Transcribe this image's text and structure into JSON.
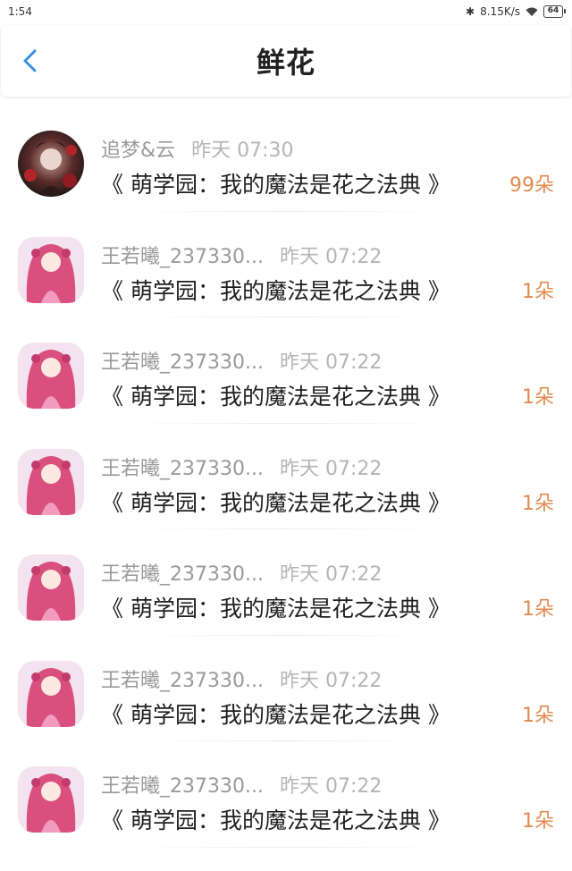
{
  "status_bar": {
    "time": "1:54",
    "bluetooth_icon": "bluetooth-icon",
    "net_speed": "8.15K/s",
    "wifi_icon": "wifi-icon",
    "battery": "64"
  },
  "header": {
    "back_icon": "chevron-left-icon",
    "title": "鲜花"
  },
  "accent_color": "#e38a4f",
  "back_color": "#3a8ee6",
  "records": [
    {
      "name": "追梦&云",
      "time": "昨天 07:30",
      "book": "《 萌学园：我的魔法是花之法典 》",
      "amount": "99朵",
      "avatar": "dark-anime-avatar"
    },
    {
      "name": "王若曦_237330...",
      "time": "昨天 07:22",
      "book": "《 萌学园：我的魔法是花之法典 》",
      "amount": "1朵",
      "avatar": "pink-anime-avatar"
    },
    {
      "name": "王若曦_237330...",
      "time": "昨天 07:22",
      "book": "《 萌学园：我的魔法是花之法典 》",
      "amount": "1朵",
      "avatar": "pink-anime-avatar"
    },
    {
      "name": "王若曦_237330...",
      "time": "昨天 07:22",
      "book": "《 萌学园：我的魔法是花之法典 》",
      "amount": "1朵",
      "avatar": "pink-anime-avatar"
    },
    {
      "name": "王若曦_237330...",
      "time": "昨天 07:22",
      "book": "《 萌学园：我的魔法是花之法典 》",
      "amount": "1朵",
      "avatar": "pink-anime-avatar"
    },
    {
      "name": "王若曦_237330...",
      "time": "昨天 07:22",
      "book": "《 萌学园：我的魔法是花之法典 》",
      "amount": "1朵",
      "avatar": "pink-anime-avatar"
    },
    {
      "name": "王若曦_237330...",
      "time": "昨天 07:22",
      "book": "《 萌学园：我的魔法是花之法典 》",
      "amount": "1朵",
      "avatar": "pink-anime-avatar"
    }
  ]
}
